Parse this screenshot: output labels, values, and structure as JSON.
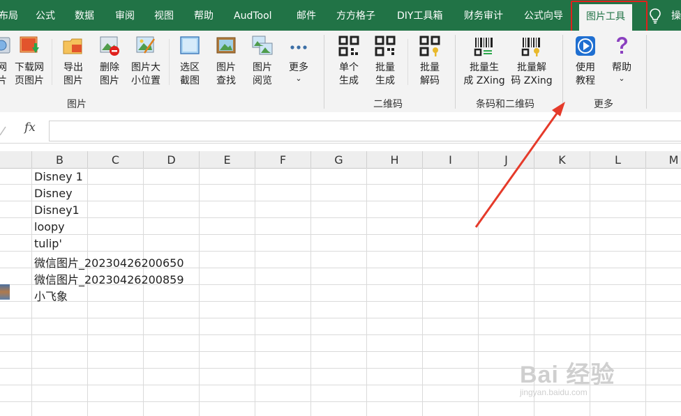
{
  "ribbon_tabs": [
    "布局",
    "公式",
    "数据",
    "审阅",
    "视图",
    "帮助",
    "AudTool",
    "邮件",
    "方方格子",
    "DIY工具箱",
    "财务审计",
    "公式向导",
    "图片工具",
    "操"
  ],
  "active_tab": "图片工具",
  "colors": {
    "ribbon_green": "#217346",
    "highlight_red": "#e0201c",
    "arrow_red": "#e53a2a"
  },
  "ribbon": {
    "buttons": {
      "web_image": "网 片",
      "download": "下载网\n页图片",
      "export": "导出\n图片",
      "delete": "删除\n图片",
      "size_position": "图片大\n小位置",
      "select_capture": "选区\n截图",
      "find": "图片\n查找",
      "browse": "图片\n阅览",
      "more": "更多",
      "qr_single": "单个\n生成",
      "qr_batch": "批量\n生成",
      "qr_decode": "批量\n解码",
      "barcode_gen": "批量生\n成 ZXing",
      "barcode_decode": "批量解\n码 ZXing",
      "tutorial": "使用\n教程",
      "help": "帮助"
    },
    "groups": {
      "pictures": "图片",
      "qrcode": "二维码",
      "barcode": "条码和二维码",
      "more": "更多"
    }
  },
  "formula_bar": {
    "fx_label": "fx",
    "value": ""
  },
  "columns": [
    "B",
    "C",
    "D",
    "E",
    "F",
    "G",
    "H",
    "I",
    "J",
    "K",
    "L",
    "M"
  ],
  "rows": [
    {
      "b": "Disney 1"
    },
    {
      "b": "Disney"
    },
    {
      "b": "Disney1"
    },
    {
      "b": "loopy"
    },
    {
      "b": "tulip'"
    },
    {
      "b": "微信图片_20230426200650"
    },
    {
      "b": "微信图片_20230426200859"
    },
    {
      "b": "小飞象"
    }
  ],
  "watermark": {
    "brand": "Bai  经验",
    "url": "jingyan.baidu.com"
  }
}
